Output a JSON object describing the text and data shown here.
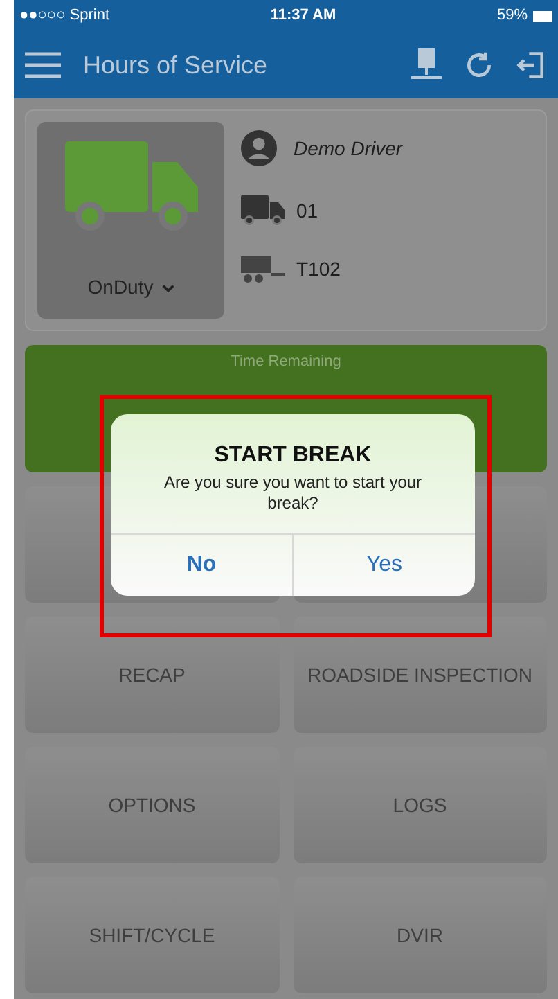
{
  "status_bar": {
    "carrier": "●●○○○ Sprint",
    "time": "11:37 AM",
    "battery": "59%"
  },
  "nav_bar": {
    "title": "Hours of Service"
  },
  "driver_card": {
    "status": "OnDuty",
    "driver": "Demo Driver",
    "truck": "01",
    "trailer": "T102"
  },
  "timer": {
    "label": "Time Remaining"
  },
  "menu_buttons": [
    {
      "kind": "hidden"
    },
    {
      "kind": "hidden"
    },
    {
      "kind": "text",
      "label": "RECAP"
    },
    {
      "kind": "text",
      "label": "ROADSIDE INSPECTION"
    },
    {
      "kind": "text",
      "label": "OPTIONS"
    },
    {
      "kind": "text",
      "label": "LOGS"
    },
    {
      "kind": "text",
      "label": "SHIFT/CYCLE"
    },
    {
      "kind": "text",
      "label": "DVIR"
    }
  ],
  "dialog": {
    "title": "START BREAK",
    "message": "Are you sure you want to start your break?",
    "buttons": [
      "No",
      "Yes"
    ]
  }
}
